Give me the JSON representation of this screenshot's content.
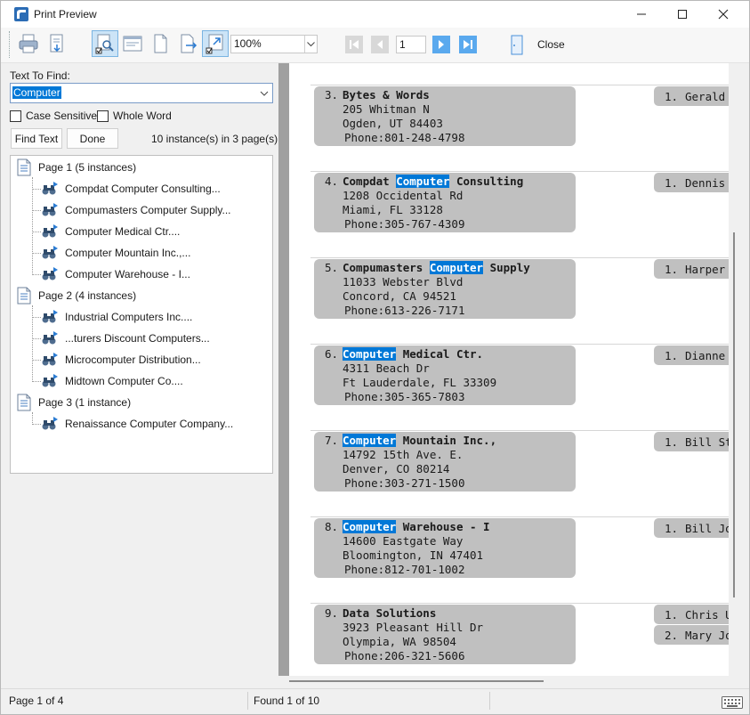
{
  "window": {
    "title": "Print Preview",
    "controls": [
      "minimize",
      "maximize",
      "close"
    ]
  },
  "toolbar": {
    "buttons": [
      {
        "icon": "print-icon"
      },
      {
        "icon": "print-setup-icon"
      },
      {
        "icon": "find-text-icon",
        "pressed": true
      },
      {
        "icon": "page-width-icon"
      },
      {
        "icon": "whole-page-icon"
      },
      {
        "icon": "export-icon"
      },
      {
        "icon": "fit-page-icon",
        "pressed": true
      }
    ],
    "zoom": "100%",
    "page_number": "1",
    "close_label": "Close"
  },
  "find_panel": {
    "label": "Text To Find:",
    "value": "Computer",
    "case_sensitive_label": "Case Sensitive",
    "case_sensitive": false,
    "whole_word_label": "Whole Word",
    "whole_word": false,
    "find_button": "Find Text",
    "done_button": "Done",
    "instances_summary": "10 instance(s) in 3 page(s)"
  },
  "results_tree": [
    {
      "label": "Page 1 (5 instances)",
      "items": [
        "Compdat Computer Consulting...",
        "Compumasters Computer Supply...",
        "Computer Medical Ctr....",
        "Computer Mountain Inc.,...",
        "Computer Warehouse - I..."
      ]
    },
    {
      "label": "Page 2 (4 instances)",
      "items": [
        "Industrial Computers Inc....",
        "...turers Discount Computers...",
        "Microcomputer Distribution...",
        "Midtown Computer Co...."
      ]
    },
    {
      "label": "Page 3 (1 instance)",
      "items": [
        "Renaissance Computer Company..."
      ]
    }
  ],
  "preview": {
    "highlight_color": "#0078d7",
    "card_color": "#c0c0c0",
    "records": [
      {
        "num": "3.",
        "name": [
          "Bytes & Words"
        ],
        "hl": [
          false
        ],
        "address": "205 Whitman N",
        "city": "Ogden, UT 84403",
        "phone_label": "Phone:",
        "phone": "801-248-4798",
        "contacts": [
          {
            "num": "1.",
            "name": "Gerald C"
          }
        ]
      },
      {
        "num": "4.",
        "name": [
          "Compdat ",
          "Computer",
          " Consulting"
        ],
        "hl": [
          false,
          true,
          false
        ],
        "address": "1208 Occidental Rd",
        "city": "Miami, FL 33128",
        "phone_label": "Phone:",
        "phone": "305-767-4309",
        "contacts": [
          {
            "num": "1.",
            "name": "Dennis"
          }
        ]
      },
      {
        "num": "5.",
        "name": [
          "Compumasters ",
          "Computer",
          " Supply"
        ],
        "hl": [
          false,
          true,
          false
        ],
        "address": "11033 Webster Blvd",
        "city": "Concord, CA 94521",
        "phone_label": "Phone:",
        "phone": "613-226-7171",
        "contacts": [
          {
            "num": "1.",
            "name": "Harper"
          }
        ]
      },
      {
        "num": "6.",
        "name": [
          "Computer",
          " Medical Ctr."
        ],
        "hl": [
          true,
          false
        ],
        "address": "4311 Beach Dr",
        "city": "Ft Lauderdale, FL 33309",
        "phone_label": "Phone:",
        "phone": "305-365-7803",
        "contacts": [
          {
            "num": "1.",
            "name": "Dianne"
          }
        ]
      },
      {
        "num": "7.",
        "name": [
          "Computer",
          " Mountain Inc.,"
        ],
        "hl": [
          true,
          false
        ],
        "address": "14792 15th Ave. E.",
        "city": "Denver, CO 80214",
        "phone_label": "Phone:",
        "phone": "303-271-1500",
        "contacts": [
          {
            "num": "1.",
            "name": "Bill Stev"
          }
        ]
      },
      {
        "num": "8.",
        "name": [
          "Computer",
          " Warehouse - I"
        ],
        "hl": [
          true,
          false
        ],
        "address": "14600 Eastgate Way",
        "city": "Bloomington, IN 47401",
        "phone_label": "Phone:",
        "phone": "812-701-1002",
        "contacts": [
          {
            "num": "1.",
            "name": "Bill Jone"
          }
        ]
      },
      {
        "num": "9.",
        "name": [
          "Data Solutions"
        ],
        "hl": [
          false
        ],
        "address": "3923 Pleasant Hill Dr",
        "city": "Olympia, WA 98504",
        "phone_label": "Phone:",
        "phone": "206-321-5606",
        "contacts": [
          {
            "num": "1.",
            "name": "Chris Ur"
          },
          {
            "num": "2.",
            "name": "Mary Jo"
          }
        ]
      }
    ]
  },
  "status": {
    "page": "Page 1 of 4",
    "found": "Found 1 of 10"
  }
}
